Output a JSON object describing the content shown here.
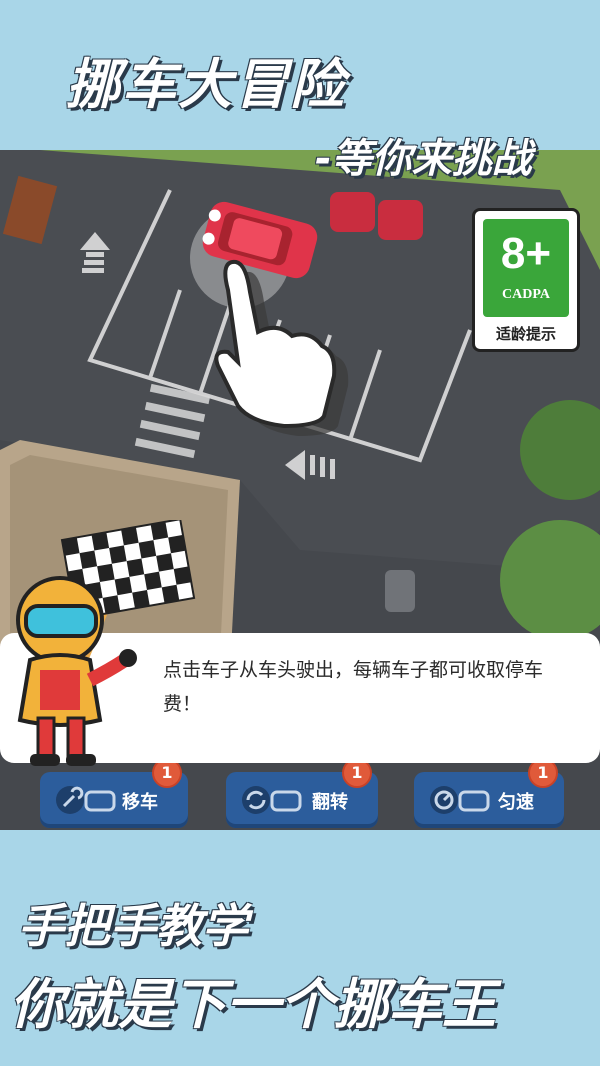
{
  "header": {
    "title": "挪车大冒险",
    "subtitle": "-等你来挑战"
  },
  "age_rating": {
    "rating": "8+",
    "organization": "CADPA",
    "hint": "适龄提示",
    "color": "#3aa63a"
  },
  "tutorial": {
    "message": "点击车子从车头驶出，每辆车子都可收取停车费！"
  },
  "toolbar": {
    "items": [
      {
        "label": "移车",
        "icon": "wrench-car-icon",
        "badge": "1"
      },
      {
        "label": "翻转",
        "icon": "rotate-car-icon",
        "badge": "1"
      },
      {
        "label": "匀速",
        "icon": "speedometer-car-icon",
        "badge": "1"
      }
    ]
  },
  "footer": {
    "line1": "手把手教学",
    "line2": "你就是下一个挪车王"
  },
  "colors": {
    "sky": "#a9d6e8",
    "asphalt": "#4a4d52",
    "car_red": "#e0344a",
    "toolbar_blue": "#2c5d9c"
  }
}
